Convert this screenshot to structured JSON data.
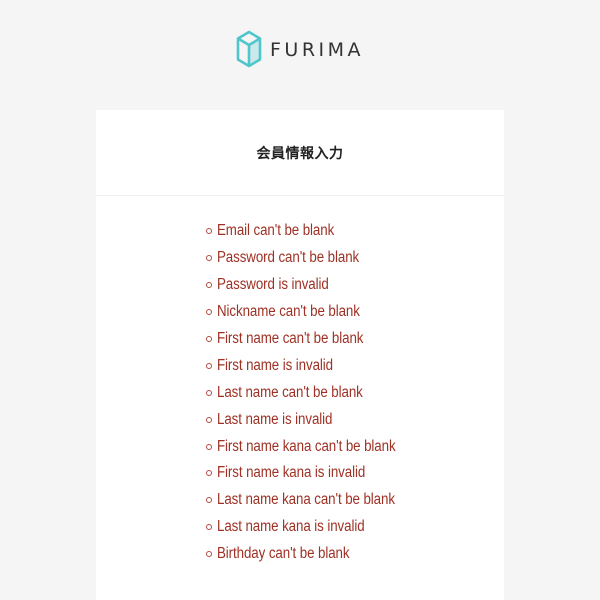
{
  "header": {
    "logo_text": "FURIMA",
    "logo_icon": "cube-logo-icon"
  },
  "form": {
    "title": "会員情報入力",
    "errors": [
      "Email can't be blank",
      "Password can't be blank",
      "Password is invalid",
      "Nickname can't be blank",
      "First name can't be blank",
      "First name is invalid",
      "Last name can't be blank",
      "Last name is invalid",
      "First name kana can't be blank",
      "First name kana is invalid",
      "Last name kana can't be blank",
      "Last name kana is invalid",
      "Birthday can't be blank"
    ]
  },
  "colors": {
    "background": "#f5f5f5",
    "card": "#ffffff",
    "logo_accent": "#4fc6cc",
    "error_text": "#9e3024"
  }
}
